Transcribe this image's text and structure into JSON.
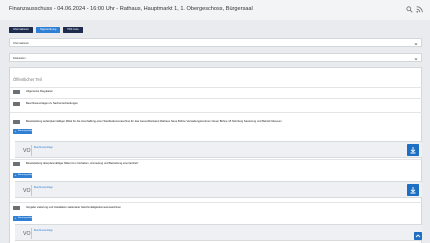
{
  "header": {
    "title": "Finanzausschuss - 04.06.2024 - 16:00 Uhr - Rathaus, Hauptmarkt 1, 1. Obergeschoss, Bürgersaal",
    "search_icon": "search-icon",
    "rss_icon": "rss-icon"
  },
  "tabs": [
    {
      "label": "Informationen",
      "active": false
    },
    {
      "label": "Tagesordnung",
      "active": true
    },
    {
      "label": "PDF Liste",
      "active": false
    }
  ],
  "accordions": [
    {
      "label": "Informationen"
    },
    {
      "label": "Diskussion"
    }
  ],
  "agenda": {
    "section_title": "Öffentlicher Teil",
    "items": [
      {
        "number": "",
        "title": "Allgemeine Regularien"
      },
      {
        "number": "",
        "title": "Beschlussvorlagen zu Sachentscheidungen"
      },
      {
        "number": "",
        "title": "Bereitstellung außerplanmäßiger Mittel für die Anschaffung einer Sterilisationsmaschine für das Gesundheitsamt Rathaus Neue Bühne Verwaltungszentrum Neuer Bühne 15 Nürnberg Sanierung und Betrieb Museum"
      },
      {
        "number": "",
        "title": "Bereitstellung überplanmäßiger Mittel zum Vorhaben „Anmietung und Betreibung einer Einheit“"
      },
      {
        "number": "",
        "title": "Vergabe Lieferung und Installation stationärer Gleichmäßigkeitsmessmaschinen"
      }
    ],
    "button_label": "Beratungsfolge",
    "doc_prefix": "VO",
    "doc_label": "Beschlussvorlage"
  },
  "colors": {
    "tab_dark": "#1d2b4f",
    "tab_active": "#2f7fd4",
    "download": "#1d6fc4"
  }
}
